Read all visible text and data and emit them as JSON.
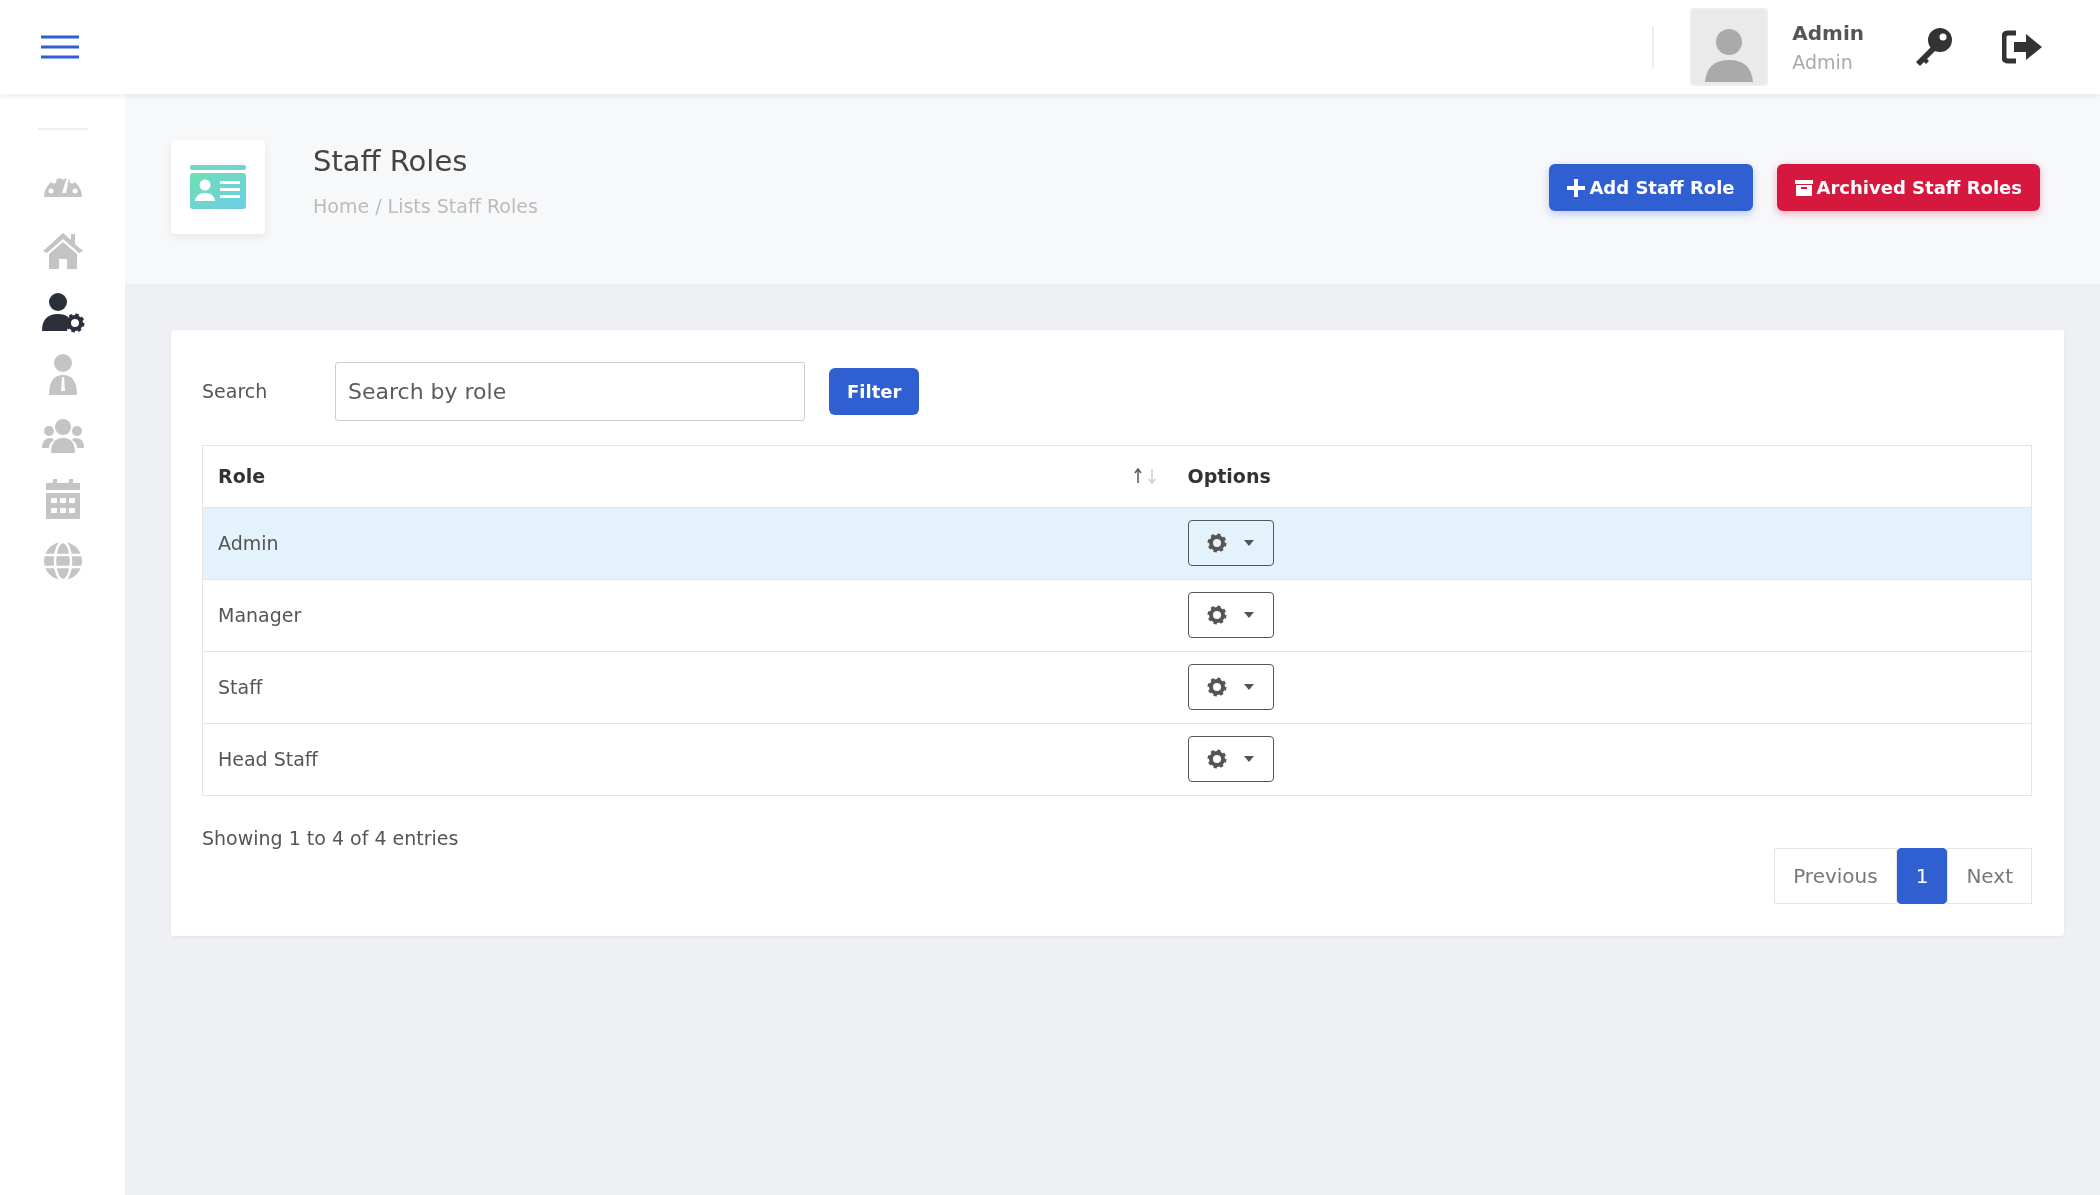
{
  "topbar": {
    "user_name": "Admin",
    "user_role": "Admin"
  },
  "sidebar": {
    "items": [
      {
        "kind": "dashboard",
        "selected": false
      },
      {
        "kind": "home",
        "selected": false
      },
      {
        "kind": "user-gear",
        "selected": true
      },
      {
        "kind": "person",
        "selected": false
      },
      {
        "kind": "group",
        "selected": false
      },
      {
        "kind": "calendar",
        "selected": false
      },
      {
        "kind": "globe",
        "selected": false
      }
    ]
  },
  "page_header": {
    "title": "Staff Roles",
    "breadcrumb": "Home / Lists Staff Roles",
    "buttons": [
      {
        "kind": "add",
        "label": "Add Staff Role"
      },
      {
        "kind": "archive",
        "label": "Archived Staff Roles"
      }
    ]
  },
  "search": {
    "label": "Search",
    "placeholder": "Search by role",
    "button": "Filter"
  },
  "table": {
    "columns": [
      "Role",
      "Options"
    ],
    "rows": [
      {
        "role": "Admin",
        "selected": true
      },
      {
        "role": "Manager",
        "selected": false
      },
      {
        "role": "Staff",
        "selected": false
      },
      {
        "role": "Head Staff",
        "selected": false
      }
    ]
  },
  "footer": {
    "info": "Showing 1 to 4 of 4 entries",
    "pagination": [
      {
        "label": "Previous",
        "selected": false
      },
      {
        "label": "1",
        "selected": true
      },
      {
        "label": "Next",
        "selected": false
      }
    ]
  }
}
